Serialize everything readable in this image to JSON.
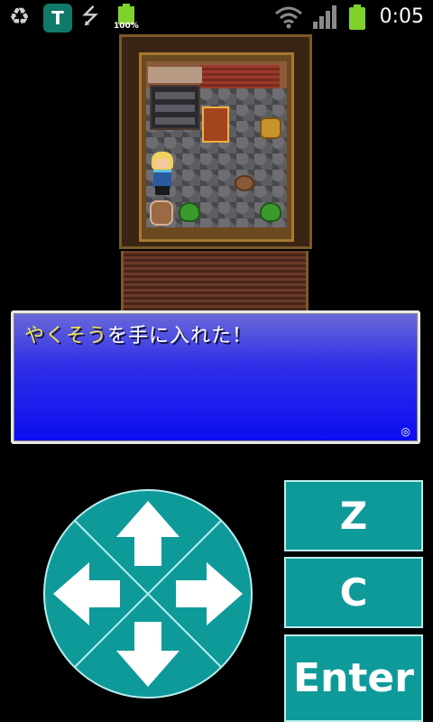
{
  "status_bar": {
    "battery_small_label": "100%",
    "time": "0:05",
    "icons": [
      "recycle-icon",
      "shield-app-icon",
      "usb-icon",
      "battery-notification-icon",
      "wifi-icon",
      "signal-icon",
      "battery-icon"
    ],
    "shield_letter": "T"
  },
  "message": {
    "item_name": "やくそう",
    "text_after": "を手に入れた！"
  },
  "controls": {
    "dpad_icons": [
      "up-arrow-icon",
      "left-arrow-icon",
      "right-arrow-icon",
      "down-arrow-icon"
    ],
    "key_z": "Z",
    "key_c": "C",
    "key_enter": "Enter"
  },
  "colors": {
    "button_teal": "#0f9a9a",
    "message_blue": "#0c0cf0",
    "item_highlight": "#f2e64a"
  }
}
